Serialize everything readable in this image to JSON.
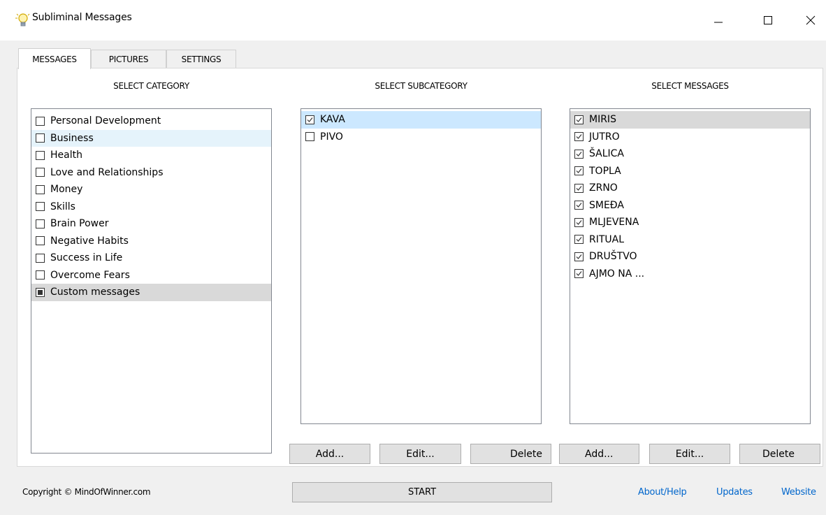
{
  "window": {
    "title": "Subliminal Messages"
  },
  "tabs": [
    "MESSAGES",
    "PICTURES",
    "SETTINGS"
  ],
  "columns": {
    "category": "SELECT CATEGORY",
    "subcategory": "SELECT SUBCATEGORY",
    "messages": "SELECT MESSAGES"
  },
  "categories": [
    {
      "label": "Personal Development",
      "state": "unchecked"
    },
    {
      "label": "Business",
      "state": "unchecked"
    },
    {
      "label": "Health",
      "state": "unchecked"
    },
    {
      "label": "Love and Relationships",
      "state": "unchecked"
    },
    {
      "label": "Money",
      "state": "unchecked"
    },
    {
      "label": "Skills",
      "state": "unchecked"
    },
    {
      "label": "Brain Power",
      "state": "unchecked"
    },
    {
      "label": "Negative Habits",
      "state": "unchecked"
    },
    {
      "label": "Success in Life",
      "state": "unchecked"
    },
    {
      "label": "Overcome Fears",
      "state": "unchecked"
    },
    {
      "label": "Custom messages",
      "state": "partial"
    }
  ],
  "subcategories": [
    {
      "label": "KAVA",
      "state": "checked"
    },
    {
      "label": "PIVO",
      "state": "unchecked"
    }
  ],
  "messages": [
    {
      "label": "MIRIS",
      "state": "checked"
    },
    {
      "label": "JUTRO",
      "state": "checked"
    },
    {
      "label": "ŠALICA",
      "state": "checked"
    },
    {
      "label": "TOPLA",
      "state": "checked"
    },
    {
      "label": "ZRNO",
      "state": "checked"
    },
    {
      "label": "SMEĐA",
      "state": "checked"
    },
    {
      "label": "MLJEVENA",
      "state": "checked"
    },
    {
      "label": "RITUAL",
      "state": "checked"
    },
    {
      "label": "DRUŠTVO",
      "state": "checked"
    },
    {
      "label": "AJMO NA ...",
      "state": "checked"
    }
  ],
  "subcategory_buttons": {
    "add": "Add...",
    "edit": "Edit...",
    "delete": "Delete"
  },
  "message_buttons": {
    "add": "Add...",
    "edit": "Edit...",
    "delete": "Delete"
  },
  "footer": {
    "copyright": "Copyright © MindOfWinner.com",
    "start": "START",
    "links": [
      "About/Help",
      "Updates",
      "Website"
    ]
  },
  "colors": {
    "link": "#0066cc",
    "selection_blue": "#cce8ff",
    "selection_gray": "#d9d9d9",
    "hover_blue": "#e5f3fb"
  }
}
